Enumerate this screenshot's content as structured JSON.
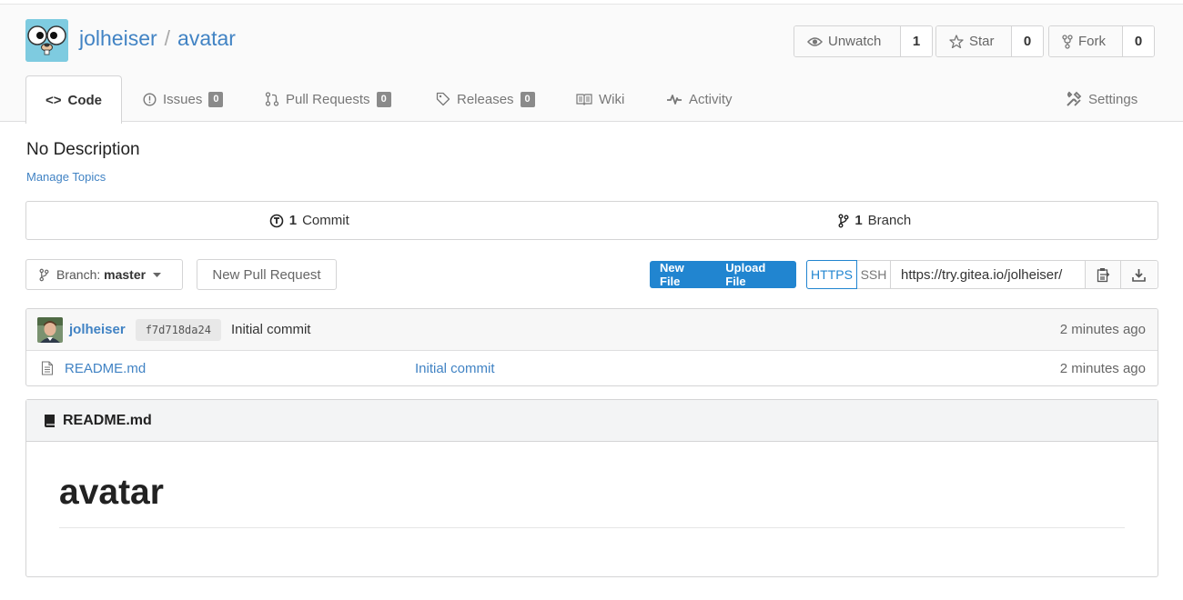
{
  "repo": {
    "owner": "jolheiser",
    "separator": "/",
    "name": "avatar"
  },
  "actions": {
    "watch": {
      "label": "Unwatch",
      "count": "1"
    },
    "star": {
      "label": "Star",
      "count": "0"
    },
    "fork": {
      "label": "Fork",
      "count": "0"
    }
  },
  "tabs": [
    {
      "label": "Code"
    },
    {
      "label": "Issues",
      "badge": "0"
    },
    {
      "label": "Pull Requests",
      "badge": "0"
    },
    {
      "label": "Releases",
      "badge": "0"
    },
    {
      "label": "Wiki"
    },
    {
      "label": "Activity"
    },
    {
      "label": "Settings"
    }
  ],
  "description": "No Description",
  "manage_topics": "Manage Topics",
  "stats": {
    "commits": {
      "count": "1",
      "label": "Commit"
    },
    "branches": {
      "count": "1",
      "label": "Branch"
    }
  },
  "branch": {
    "prefix": "Branch:",
    "name": "master"
  },
  "new_pull_request": "New Pull Request",
  "file_actions": {
    "new_file": "New File",
    "upload_file": "Upload File"
  },
  "clone": {
    "https": "HTTPS",
    "ssh": "SSH",
    "url": "https://try.gitea.io/jolheiser/"
  },
  "latest_commit": {
    "author": "jolheiser",
    "sha": "f7d718da24",
    "message": "Initial commit",
    "time": "2 minutes ago"
  },
  "files": [
    {
      "name": "README.md",
      "commit": "Initial commit",
      "time": "2 minutes ago"
    }
  ],
  "readme": {
    "filename": "README.md",
    "heading": "avatar"
  },
  "colors": {
    "accent": "#2185d0",
    "link": "#4183c4",
    "logo_bg": "#7ecbe0"
  }
}
